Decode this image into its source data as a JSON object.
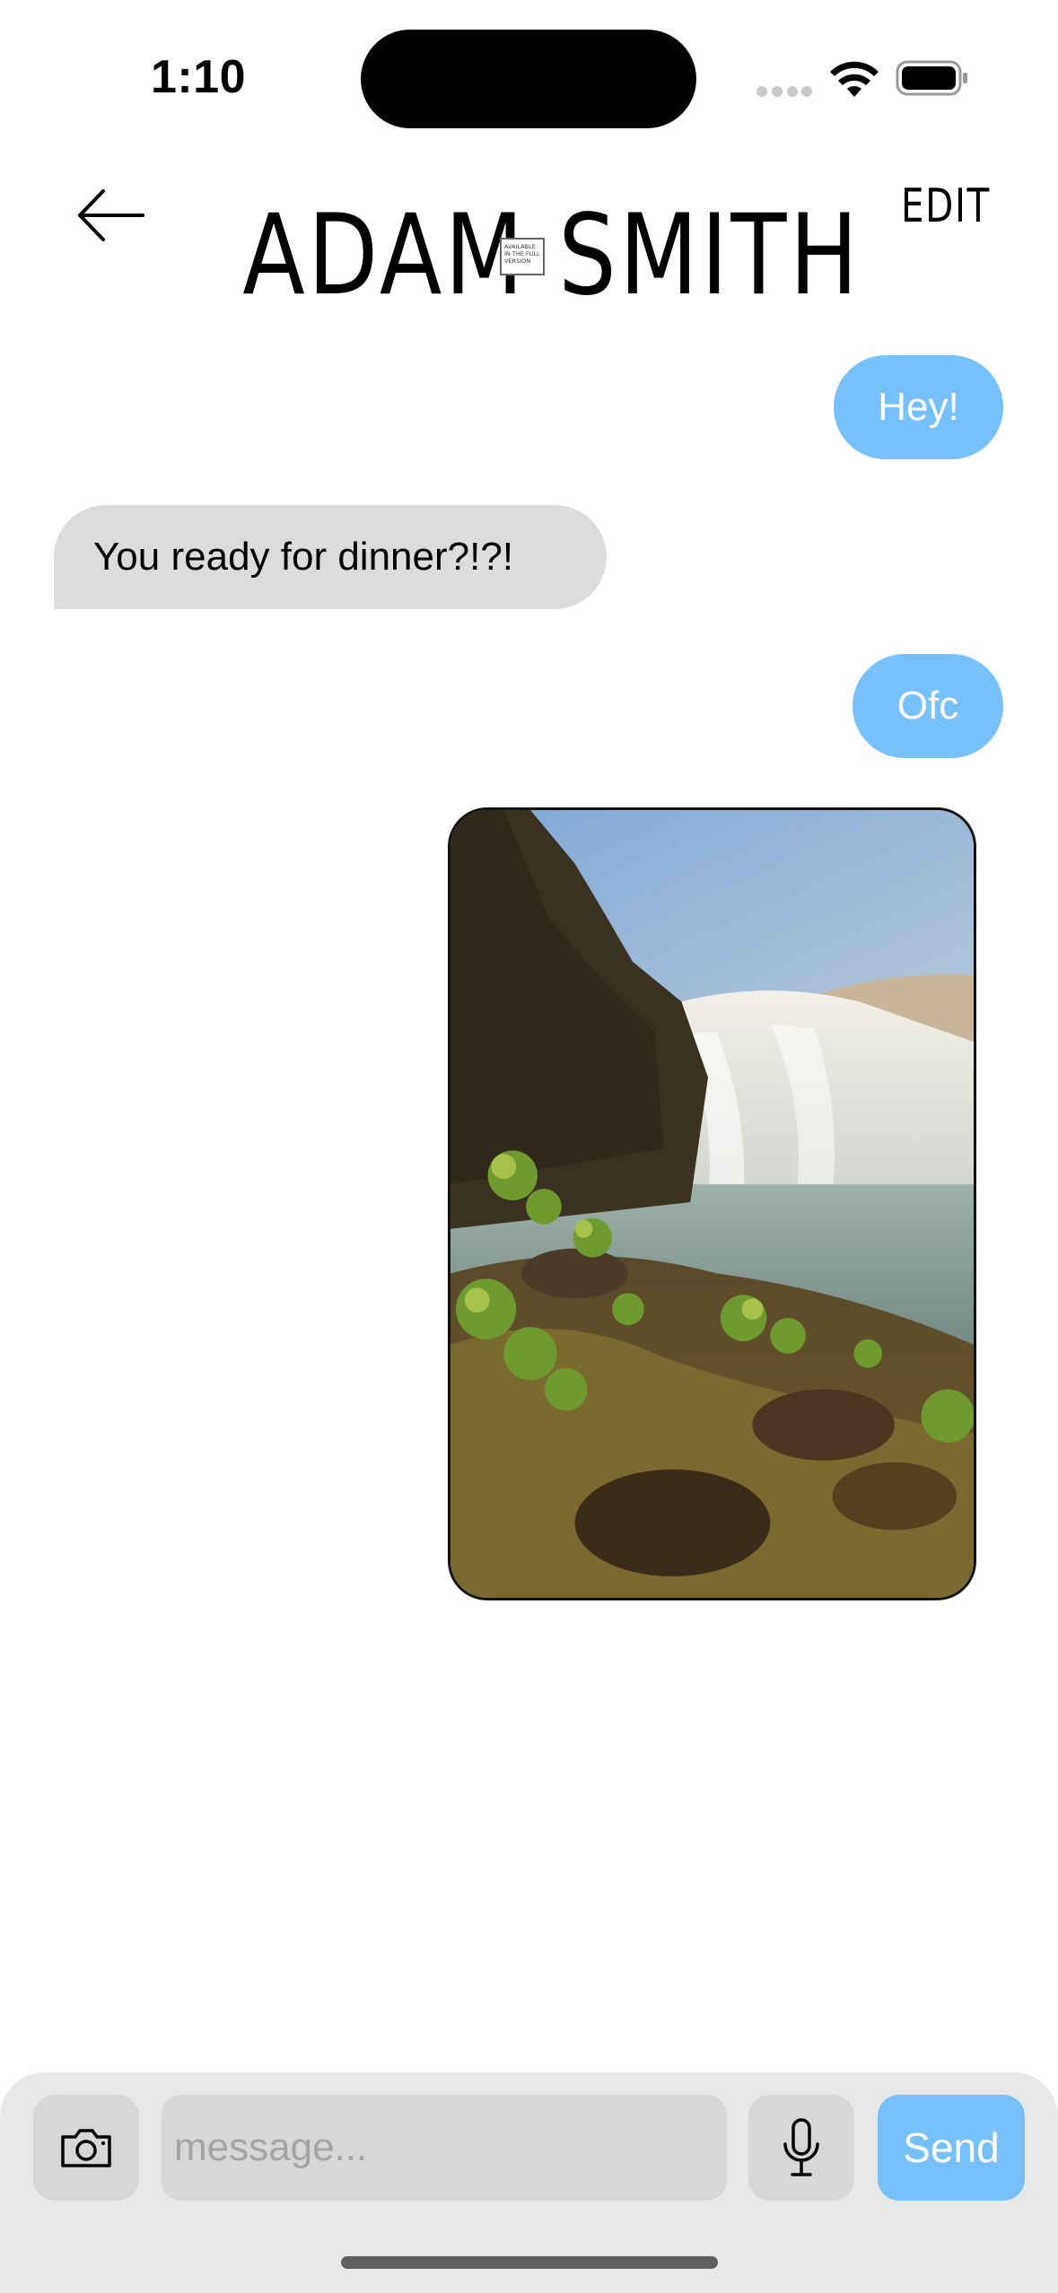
{
  "status_bar": {
    "time": "1:10"
  },
  "header": {
    "contact_name": "ADAM SMITH",
    "badge_text": "AVAILABLE IN THE FULL VERSION",
    "edit_label": "EDIT"
  },
  "messages": [
    {
      "direction": "sent",
      "text": "Hey!"
    },
    {
      "direction": "received",
      "text": "You ready for dinner?!?!"
    },
    {
      "direction": "sent",
      "text": "Ofc"
    },
    {
      "direction": "sent",
      "type": "image",
      "subject": "waterfall with mossy rocks and green plants"
    }
  ],
  "composer": {
    "placeholder": "message...",
    "send_label": "Send"
  },
  "colors": {
    "sent_bubble": "#76c0fb",
    "received_bubble": "#dcdcdc",
    "composer_bg": "#e8e8e8",
    "control_bg": "#d7d7d7"
  },
  "icons": [
    "back-arrow-icon",
    "camera-icon",
    "microphone-icon",
    "wifi-icon",
    "battery-icon",
    "signal-icon"
  ]
}
